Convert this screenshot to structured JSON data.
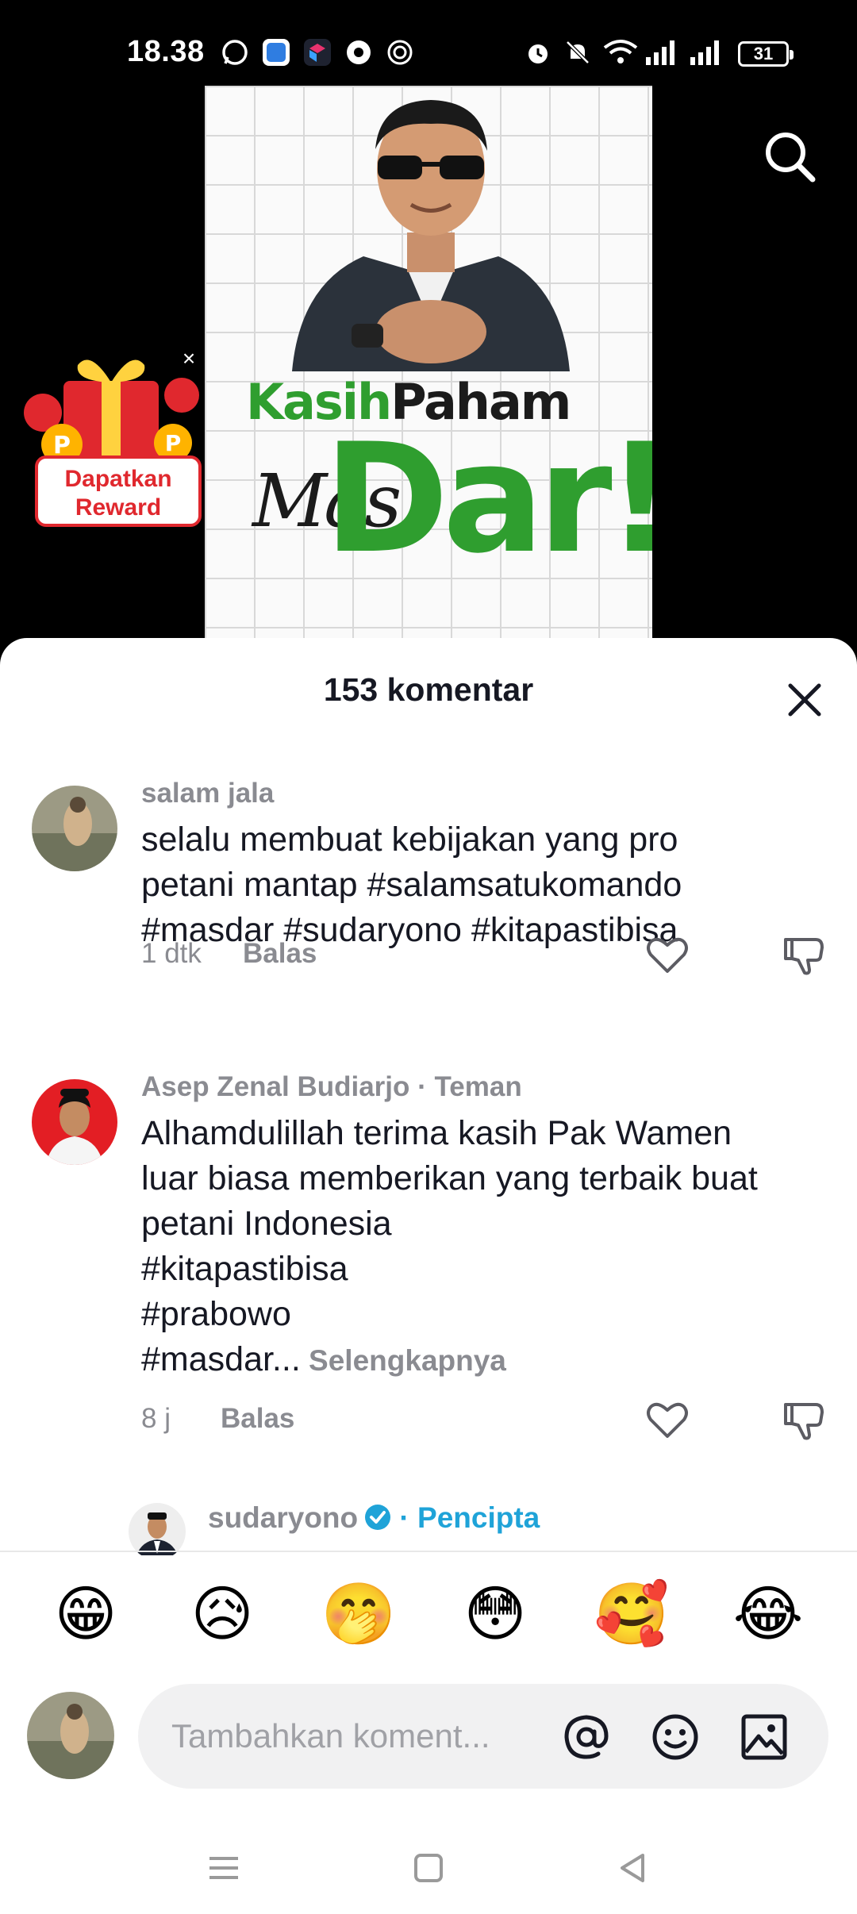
{
  "status_bar": {
    "time": "18.38",
    "battery": "31"
  },
  "poster": {
    "line1_green": "Kasih",
    "line1_dark": "Paham",
    "line2_mas": "Mas",
    "line2_dar": "Dar!"
  },
  "reward": {
    "label_line1": "Dapatkan",
    "label_line2": "Reward",
    "close": "×"
  },
  "sheet": {
    "title": "153 komentar"
  },
  "comments": [
    {
      "username": "salam jala",
      "text": "selalu membuat kebijakan yang pro\npetani mantap #salamsatukomando\n#masdar #sudaryono #kitapastibisa",
      "time": "1 dtk",
      "reply": "Balas"
    },
    {
      "username": "Asep Zenal Budiarjo",
      "friend_tag": " · Teman",
      "text": "Alhamdulillah terima kasih Pak Wamen\nluar biasa memberikan yang terbaik buat\npetani Indonesia\n#kitapastibisa\n#prabowo\n#masdar...",
      "see_more": " Selengkapnya",
      "time": "8 j",
      "reply": "Balas"
    }
  ],
  "creator_reply": {
    "username": "sudaryono",
    "tag": " · Pencipta"
  },
  "emojis": [
    "😁",
    "😥",
    "🤭",
    "😳",
    "🥰",
    "😂"
  ],
  "input": {
    "placeholder": "Tambahkan koment..."
  },
  "colors": {
    "accent_blue": "#1fa3d8",
    "poster_green": "#2f9e2f",
    "reward_red": "#e0282e"
  }
}
